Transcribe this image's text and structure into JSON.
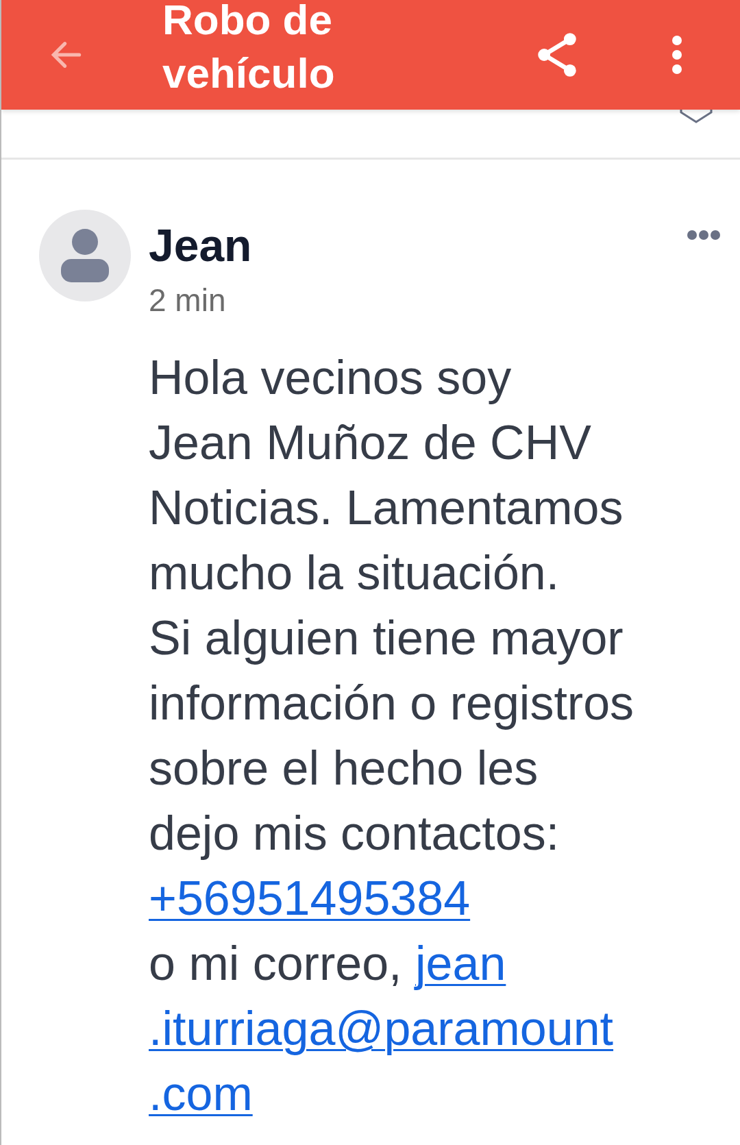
{
  "header": {
    "title": "Robo de vehículo"
  },
  "post": {
    "author": "Jean",
    "time": "2 min",
    "lines": [
      [
        {
          "text": "Hola vecinos soy",
          "link": false
        }
      ],
      [
        {
          "text": "Jean Muñoz de CHV",
          "link": false
        }
      ],
      [
        {
          "text": "Noticias. Lamentamos",
          "link": false
        }
      ],
      [
        {
          "text": "mucho la situación.",
          "link": false
        }
      ],
      [
        {
          "text": "Si alguien tiene mayor",
          "link": false
        }
      ],
      [
        {
          "text": "información o registros",
          "link": false
        }
      ],
      [
        {
          "text": "sobre el hecho les",
          "link": false
        }
      ],
      [
        {
          "text": "dejo mis contactos:",
          "link": false
        }
      ],
      [
        {
          "text": "+56951495384",
          "link": true
        }
      ],
      [
        {
          "text": "o mi correo, ",
          "link": false
        },
        {
          "text": "jean",
          "link": true
        }
      ],
      [
        {
          "text": ".iturriaga@paramount",
          "link": true
        }
      ],
      [
        {
          "text": ".com",
          "link": true
        }
      ]
    ]
  }
}
